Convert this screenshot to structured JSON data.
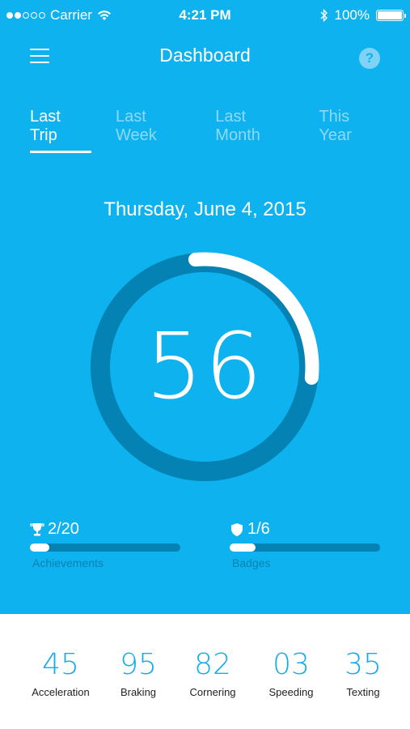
{
  "status_bar": {
    "carrier": "Carrier",
    "time": "4:21 PM",
    "battery": "100%"
  },
  "header": {
    "title": "Dashboard",
    "help": "?"
  },
  "tabs": [
    {
      "label": "Last Trip",
      "active": true
    },
    {
      "label": "Last Week",
      "active": false
    },
    {
      "label": "Last Month",
      "active": false
    },
    {
      "label": "This Year",
      "active": false
    }
  ],
  "trip": {
    "date": "Thursday, June 4, 2015",
    "score": "56",
    "score_progress": 0.28
  },
  "achievements": {
    "value": "2/20",
    "label": "Achievements",
    "progress": 0.1
  },
  "badges": {
    "value": "1/6",
    "label": "Badges",
    "progress": 0.17
  },
  "stats": [
    {
      "value": "45",
      "label": "Acceleration"
    },
    {
      "value": "95",
      "label": "Braking"
    },
    {
      "value": "82",
      "label": "Cornering"
    },
    {
      "value": "03",
      "label": "Speeding"
    },
    {
      "value": "35",
      "label": "Texting"
    }
  ],
  "colors": {
    "primary": "#0eb2ef",
    "track": "#0382b3",
    "highlight": "#ffffff",
    "stat_value": "#13aeea"
  }
}
